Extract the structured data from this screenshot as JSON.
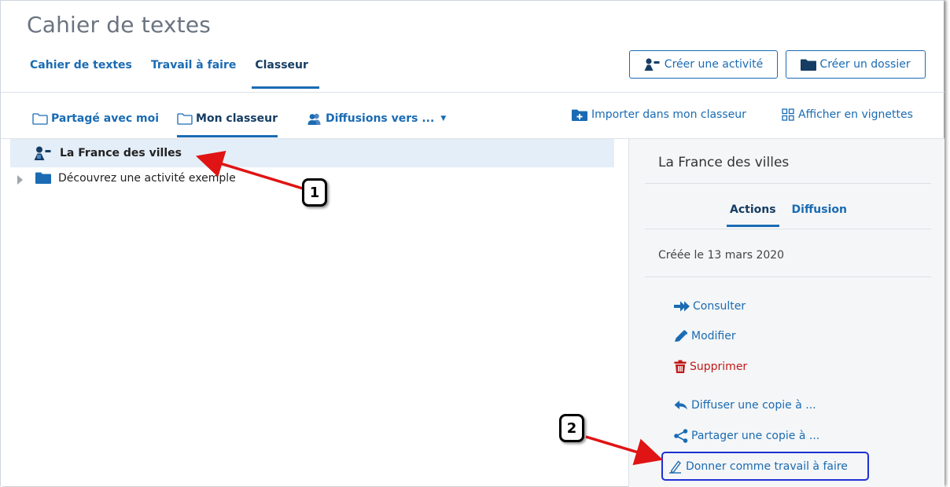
{
  "app": {
    "title": "Cahier de textes"
  },
  "main_tabs": [
    {
      "label": "Cahier de textes",
      "active": false
    },
    {
      "label": "Travail à faire",
      "active": false
    },
    {
      "label": "Classeur",
      "active": true
    }
  ],
  "header_buttons": {
    "create_activity": "Créer une activité",
    "create_folder": "Créer un dossier"
  },
  "sub_tabs": {
    "shared": "Partagé avec moi",
    "my_binder": "Mon classeur",
    "broadcasts": "Diffusions vers ..."
  },
  "toolbar": {
    "import": "Importer dans mon classeur",
    "thumbnails": "Afficher en vignettes"
  },
  "tree": {
    "selected_item": "La France des villes",
    "folder_item": "Découvrez une activité exemple"
  },
  "side_panel": {
    "title": "La France des villes",
    "tabs": [
      {
        "label": "Actions",
        "active": true
      },
      {
        "label": "Diffusion",
        "active": false
      }
    ],
    "created": "Créée le 13 mars 2020",
    "actions": {
      "consult": "Consulter",
      "edit": "Modifier",
      "delete": "Supprimer",
      "broadcast_copy": "Diffuser une copie à ...",
      "share_copy": "Partager une copie à ...",
      "assign_homework": "Donner comme travail à faire"
    }
  },
  "annotations": {
    "step1": "1",
    "step2": "2"
  },
  "colors": {
    "accent": "#1a6bb3",
    "active_tab_text": "#153d63",
    "danger": "#c21818",
    "highlight_box": "#1f2fd6",
    "selection_bg": "#e4eef8",
    "side_bg": "#f5f6f7",
    "annotation_arrow": "#e01414"
  },
  "icons": {
    "create_activity": "activity-person-icon",
    "create_folder": "folder-icon",
    "shared": "folder-outline-icon",
    "my_binder": "folder-outline-icon",
    "broadcasts": "users-icon",
    "import": "folder-plus-icon",
    "thumbnails": "grid-icon",
    "consult": "arrow-right-icon",
    "edit": "pencil-icon",
    "delete": "trash-icon",
    "broadcast_copy": "reply-icon",
    "share_copy": "share-icon",
    "assign_homework": "hand-writing-icon"
  }
}
